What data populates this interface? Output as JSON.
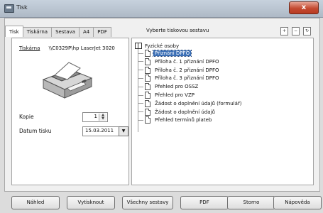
{
  "window": {
    "title": "Tisk",
    "close_label": "x"
  },
  "tabs": [
    "Tisk",
    "Tiskárna",
    "Sestava",
    "A4",
    "PDF"
  ],
  "tab_description": "Vyberte tiskovou sestavu",
  "toolbar_icons": [
    "expand-icon",
    "collapse-icon",
    "refresh-icon"
  ],
  "printer": {
    "link_label": "Tiskárna",
    "name": "\\\\C0329P\\hp LaserJet 3020"
  },
  "fields": {
    "copies_label": "Kopie",
    "copies_value": "1",
    "date_label": "Datum tisku",
    "date_value": "15.03.2011"
  },
  "tree": {
    "root": "Fyzické osoby",
    "items": [
      "Přiznání DPFO",
      "Příloha č. 1 přiznání DPFO",
      "Příloha č. 2 přiznání DPFO",
      "Příloha č. 3 přiznání DPFO",
      "Přehled pro OSSZ",
      "Přehled pro VZP",
      "Žádost o doplnění údajů (formulář)",
      "Žádost o doplnění údajů",
      "Přehled termínů plateb"
    ],
    "selected_index": 0
  },
  "buttons": [
    "Náhled",
    "Vytisknout",
    "Všechny sestavy",
    "PDF",
    "Storno",
    "Nápověda"
  ]
}
